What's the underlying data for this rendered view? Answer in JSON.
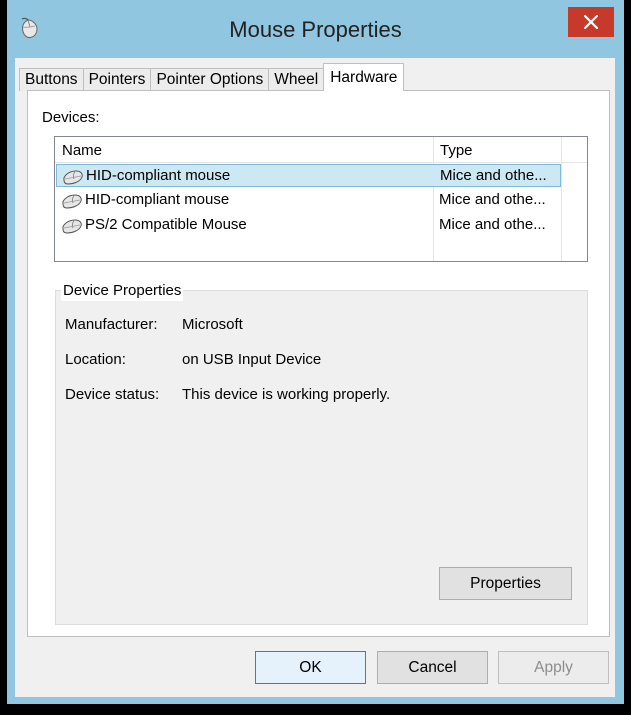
{
  "window": {
    "title": "Mouse Properties",
    "accent_color": "#90c6e0",
    "close_color": "#c7392b"
  },
  "tabs": [
    {
      "label": "Buttons",
      "active": false
    },
    {
      "label": "Pointers",
      "active": false
    },
    {
      "label": "Pointer Options",
      "active": false
    },
    {
      "label": "Wheel",
      "active": false
    },
    {
      "label": "Hardware",
      "active": true
    }
  ],
  "devices": {
    "label": "Devices:",
    "columns": {
      "name": "Name",
      "type": "Type"
    },
    "rows": [
      {
        "name": "HID-compliant mouse",
        "type": "Mice and othe...",
        "selected": true
      },
      {
        "name": "HID-compliant mouse",
        "type": "Mice and othe...",
        "selected": false
      },
      {
        "name": "PS/2 Compatible Mouse",
        "type": "Mice and othe...",
        "selected": false
      }
    ]
  },
  "device_properties": {
    "title": "Device Properties",
    "manufacturer_label": "Manufacturer:",
    "manufacturer_value": "Microsoft",
    "location_label": "Location:",
    "location_value": "on USB Input Device",
    "status_label": "Device status:",
    "status_value": "This device is working properly.",
    "properties_button": "Properties"
  },
  "footer": {
    "ok": "OK",
    "cancel": "Cancel",
    "apply": "Apply"
  }
}
